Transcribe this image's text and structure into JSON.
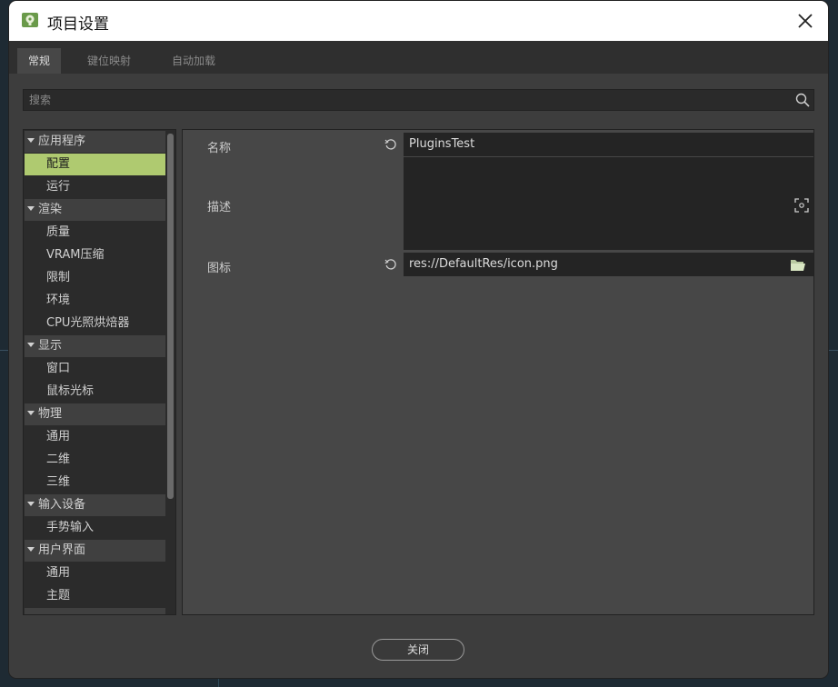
{
  "window": {
    "title": "项目设置",
    "app_icon": "godot-icon"
  },
  "tabs": [
    {
      "label": "常规",
      "active": true
    },
    {
      "label": "键位映射",
      "active": false
    },
    {
      "label": "自动加载",
      "active": false
    }
  ],
  "search": {
    "placeholder": "搜索",
    "icon": "search-icon"
  },
  "tree": {
    "items": [
      {
        "label": "应用程序",
        "type": "section"
      },
      {
        "label": "配置",
        "type": "child",
        "selected": true
      },
      {
        "label": "运行",
        "type": "child"
      },
      {
        "label": "渲染",
        "type": "section"
      },
      {
        "label": "质量",
        "type": "child"
      },
      {
        "label": "VRAM压缩",
        "type": "child"
      },
      {
        "label": "限制",
        "type": "child"
      },
      {
        "label": "环境",
        "type": "child"
      },
      {
        "label": "CPU光照烘焙器",
        "type": "child"
      },
      {
        "label": "显示",
        "type": "section"
      },
      {
        "label": "窗口",
        "type": "child"
      },
      {
        "label": "鼠标光标",
        "type": "child"
      },
      {
        "label": "物理",
        "type": "section"
      },
      {
        "label": "通用",
        "type": "child"
      },
      {
        "label": "二维",
        "type": "child"
      },
      {
        "label": "三维",
        "type": "child"
      },
      {
        "label": "输入设备",
        "type": "section"
      },
      {
        "label": "手势输入",
        "type": "child"
      },
      {
        "label": "用户界面",
        "type": "section"
      },
      {
        "label": "通用",
        "type": "child"
      },
      {
        "label": "主题",
        "type": "child"
      }
    ]
  },
  "properties": {
    "name": {
      "label": "名称",
      "value": "PluginsTest"
    },
    "description": {
      "label": "描述",
      "value": ""
    },
    "icon": {
      "label": "图标",
      "value": "res://DefaultRes/icon.png"
    }
  },
  "footer": {
    "close_label": "关闭"
  },
  "colors": {
    "accent": "#afca70",
    "panel": "#474747",
    "field": "#242424"
  }
}
